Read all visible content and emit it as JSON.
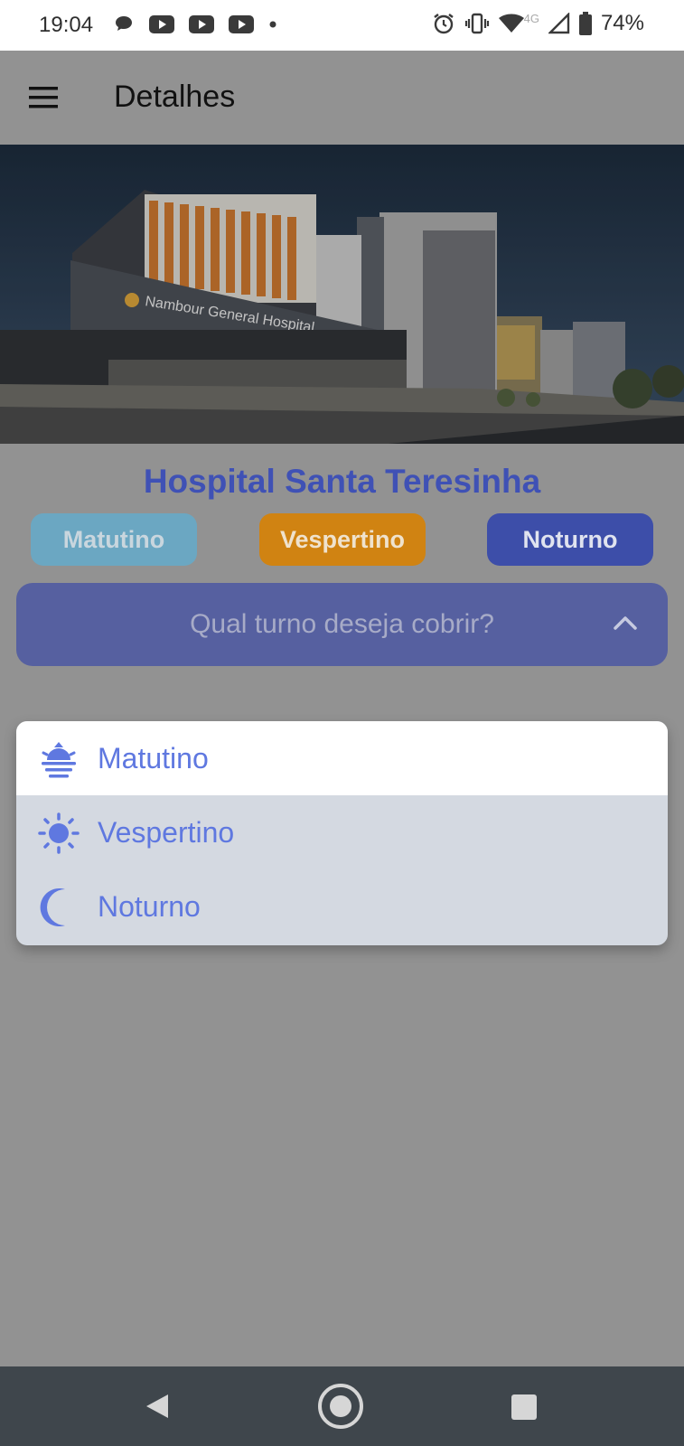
{
  "status_bar": {
    "time": "19:04",
    "network": "4G",
    "battery": "74%",
    "icons": [
      "chat-icon",
      "youtube-icon",
      "youtube-icon",
      "youtube-icon",
      "dot-icon",
      "alarm-icon",
      "vibrate-icon",
      "wifi-icon",
      "signal-icon",
      "battery-icon"
    ]
  },
  "app_bar": {
    "menu_icon": "hamburger-menu-icon",
    "title": "Detalhes"
  },
  "hero": {
    "sign_text": "Nambour General Hospital"
  },
  "hospital": {
    "name": "Hospital Santa Teresinha"
  },
  "shift_buttons": {
    "matutino": "Matutino",
    "vespertino": "Vespertino",
    "noturno": "Noturno"
  },
  "dropdown": {
    "label": "Qual turno deseja cobrir?",
    "icon": "chevron-up-icon"
  },
  "menu": {
    "options": [
      {
        "label": "Matutino",
        "icon": "sunrise-icon"
      },
      {
        "label": "Vespertino",
        "icon": "sun-icon"
      },
      {
        "label": "Noturno",
        "icon": "moon-icon"
      }
    ]
  },
  "colors": {
    "accent": "#5f78e0",
    "title": "#3f51b5",
    "matutino": "#6ba7c2",
    "vespertino": "#d08312",
    "noturno": "#3d4ea9"
  },
  "nav_bar": {
    "icons": [
      "back-icon",
      "home-icon",
      "recent-apps-icon"
    ]
  }
}
